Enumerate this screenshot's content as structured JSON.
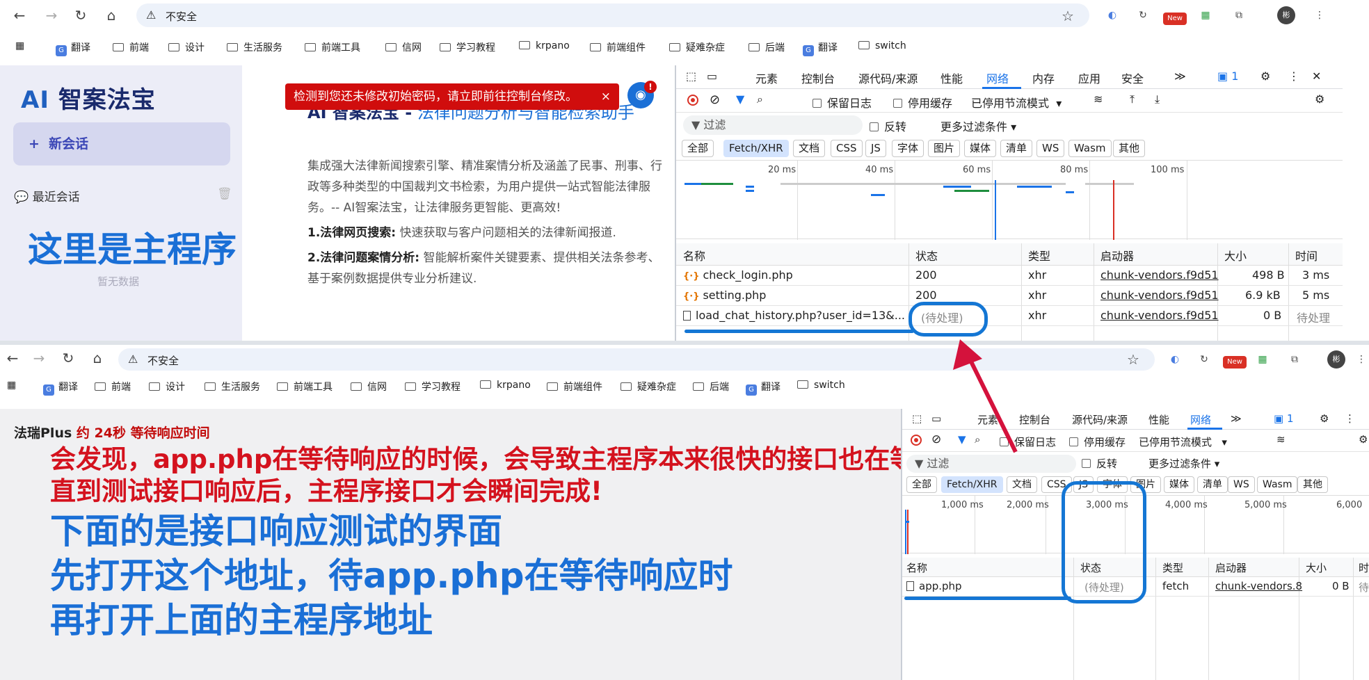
{
  "browser": {
    "security_label": "不安全",
    "bookmarks": [
      "翻译",
      "前端",
      "设计",
      "生活服务",
      "前端工具",
      "信网",
      "学习教程",
      "krpano",
      "前端组件",
      "疑难杂症",
      "后端",
      "翻译",
      "switch"
    ],
    "ext_new_badge": "New",
    "profile_initial": "彬"
  },
  "app_top": {
    "logo_prefix": "AI ",
    "logo_main": "智案法宝",
    "new_chat_label": "新会话",
    "recent_label": "最近会话",
    "main_program_annotation": "这里是主程序",
    "no_data": "暂无数据",
    "toast_text": "检测到您还未修改初始密码，请立即前往控制台修改。",
    "toast_close": "×",
    "avatar_badge": "!",
    "title_bold": "AI 智案法宝 -",
    "title_rest": " 法律问题分析与智能检索助手",
    "intro": "集成强大法律新闻搜索引擎、精准案情分析及涵盖了民事、刑事、行政等多种类型的中国裁判文书检索，为用户提供一站式智能法律服务。-- AI智案法宝，让法律服务更智能、更高效!",
    "feature1_title": "1.法律网页搜索:",
    "feature1_text": " 快速获取与客户问题相关的法律新闻报道.",
    "feature2_title": "2.法律问题案情分析:",
    "feature2_text": " 智能解析案件关键要素、提供相关法条参考、基于案例数据提供专业分析建议."
  },
  "devtools_top": {
    "tabs": [
      "元素",
      "控制台",
      "源代码/来源",
      "性能",
      "网络",
      "内存",
      "应用",
      "安全"
    ],
    "more_tabs": "≫",
    "issues_count": "1",
    "preserve_log": "保留日志",
    "disable_cache": "停用缓存",
    "throttling": "已停用节流模式",
    "filter_placeholder": "过滤",
    "invert": "反转",
    "more_filters": "更多过滤条件",
    "type_chips": [
      "全部",
      "Fetch/XHR",
      "文档",
      "CSS",
      "JS",
      "字体",
      "图片",
      "媒体",
      "清单",
      "WS",
      "Wasm",
      "其他"
    ],
    "timeline_ticks": [
      "20 ms",
      "40 ms",
      "60 ms",
      "80 ms",
      "100 ms"
    ],
    "columns": [
      "名称",
      "状态",
      "类型",
      "启动器",
      "大小",
      "时间"
    ],
    "rows": [
      {
        "name": "check_login.php",
        "status": "200",
        "type": "xhr",
        "initiator": "chunk-vendors.f9d51",
        "size": "498 B",
        "time": "3 ms"
      },
      {
        "name": "setting.php",
        "status": "200",
        "type": "xhr",
        "initiator": "chunk-vendors.f9d51",
        "size": "6.9 kB",
        "time": "5 ms"
      },
      {
        "name": "load_chat_history.php?user_id=13&...",
        "status": "(待处理)",
        "type": "xhr",
        "initiator": "chunk-vendors.f9d51",
        "size": "0 B",
        "time": "待处理"
      }
    ]
  },
  "page_bottom": {
    "title": "法瑞Plus",
    "title_wait": " 约 24秒 等待响应时间",
    "annotation_red_1": "会发现，app.php在等待响应的时候，会导致主程序本来很快的接口也在等待响应!",
    "annotation_red_2": "直到测试接口响应后，主程序接口才会瞬间完成!",
    "annotation_blue_1": "下面的是接口响应测试的界面",
    "annotation_blue_2": "先打开这个地址，待app.php在等待响应时",
    "annotation_blue_3": "再打开上面的主程序地址"
  },
  "devtools_bottom": {
    "tabs": [
      "元素",
      "控制台",
      "源代码/来源",
      "性能",
      "网络"
    ],
    "more_tabs": "≫",
    "issues_count": "1",
    "preserve_log": "保留日志",
    "disable_cache": "停用缓存",
    "throttling": "已停用节流模式",
    "filter_placeholder": "过滤",
    "invert": "反转",
    "more_filters": "更多过滤条件",
    "type_chips": [
      "全部",
      "Fetch/XHR",
      "文档",
      "CSS",
      "JS",
      "字体",
      "图片",
      "媒体",
      "清单",
      "WS",
      "Wasm",
      "其他"
    ],
    "timeline_ticks": [
      "1,000 ms",
      "2,000 ms",
      "3,000 ms",
      "4,000 ms",
      "5,000 ms",
      "6,000"
    ],
    "columns": [
      "名称",
      "状态",
      "类型",
      "启动器",
      "大小",
      "时"
    ],
    "row": {
      "name": "app.php",
      "status": "(待处理)",
      "type": "fetch",
      "initiator": "chunk-vendors.8",
      "size": "0 B",
      "time": "待"
    }
  },
  "colors": {
    "accent": "#1a73e8",
    "annotation_blue": "#1a6fd6",
    "annotation_red": "#d4121e",
    "highlight": "#1476d4",
    "arrow": "#d4123c"
  }
}
